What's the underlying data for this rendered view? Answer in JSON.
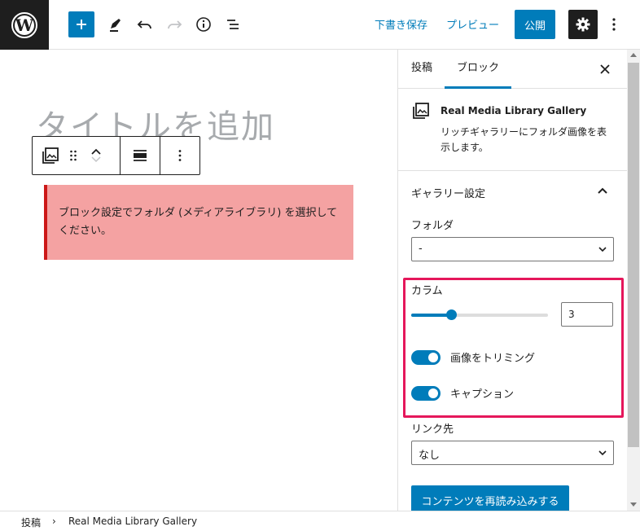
{
  "toolbar": {
    "save_draft": "下書き保存",
    "preview": "プレビュー",
    "publish": "公開"
  },
  "editor": {
    "title_placeholder": "タイトルを追加",
    "notice": "ブロック設定でフォルダ (メディアライブラリ) を選択してください。"
  },
  "sidebar": {
    "tabs": [
      {
        "label": "投稿",
        "active": false
      },
      {
        "label": "ブロック",
        "active": true
      }
    ],
    "block": {
      "title": "Real Media Library Gallery",
      "description": "リッチギャラリーにフォルダ画像を表示します。"
    },
    "panel": {
      "title": "ギャラリー設定",
      "folder_label": "フォルダ",
      "folder_value": "-",
      "columns_label": "カラム",
      "columns_value": "3",
      "columns_slider_fraction": 0.29,
      "crop_label": "画像をトリミング",
      "crop_on": true,
      "caption_label": "キャプション",
      "caption_on": true,
      "link_label": "リンク先",
      "link_value": "なし",
      "reload_button": "コンテンツを再読み込みする"
    }
  },
  "breadcrumb": {
    "root": "投稿",
    "separator": "›",
    "current": "Real Media Library Gallery"
  },
  "colors": {
    "accent": "#007cba",
    "dark": "#1e1e1e",
    "notice_bg": "#f4a2a2",
    "notice_border": "#cc1818",
    "highlight": "#e5175b"
  },
  "icons": [
    "wordpress-logo-icon",
    "plus-icon",
    "pencil-icon",
    "undo-icon",
    "redo-icon",
    "info-icon",
    "list-view-icon",
    "gear-icon",
    "kebab-menu-icon",
    "gallery-icon",
    "drag-handle-icon",
    "chevron-up-icon",
    "chevron-down-icon",
    "align-icon",
    "close-icon"
  ]
}
